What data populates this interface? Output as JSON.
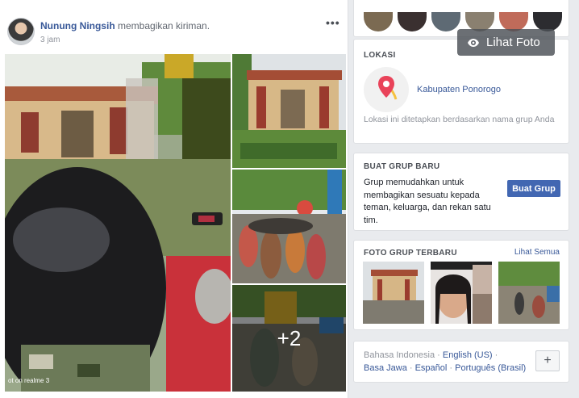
{
  "post": {
    "author": "Nunung Ningsih",
    "action": "membagikan kiriman.",
    "time": "3 jam",
    "more_label": "•••",
    "more_photos": "+2",
    "camera_credit": "ot on realme 3"
  },
  "overlay": {
    "view_photo": "Lihat Foto",
    "icon": "eye-icon"
  },
  "location": {
    "title": "LOKASI",
    "name": "Kabupaten Ponorogo",
    "note": "Lokasi ini ditetapkan berdasarkan nama grup Anda"
  },
  "create_group": {
    "title": "BUAT GRUP BARU",
    "description": "Grup memudahkan untuk membagikan sesuatu kepada teman, keluarga, dan rekan satu tim.",
    "button": "Buat Grup"
  },
  "recent_photos": {
    "title": "FOTO GRUP TERBARU",
    "see_all": "Lihat Semua"
  },
  "languages": {
    "current": "Bahasa Indonesia",
    "sep": " · ",
    "english": "English (US)",
    "row2": [
      "Basa Jawa",
      "Español",
      "Português (Brasil)"
    ],
    "add_label": "+"
  },
  "colors": {
    "link": "#385898",
    "button": "#4267b2",
    "background": "#e9ebee"
  }
}
